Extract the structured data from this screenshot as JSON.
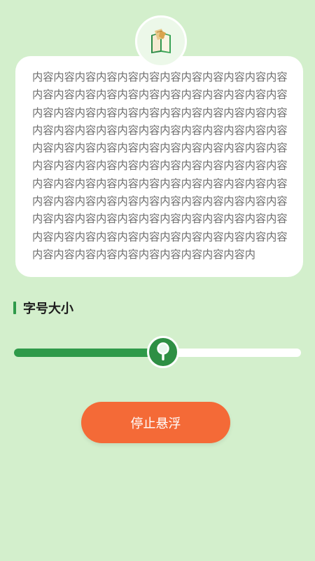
{
  "header": {
    "icon": "book-icon"
  },
  "preview": {
    "text": "内容内容内容内容内容内容内容内容内容内容内容内容内容内容内容内容内容内容内容内容内容内容内容内容内容内容内容内容内容内容内容内容内容内容内容内容内容内容内容内容内容内容内容内容内容内容内容内容内容内容内容内容内容内容内容内容内容内容内容内容内容内容内容内容内容内容内容内容内容内容内容内容内容内容内容内容内容内容内容内容内容内容内容内容内容内容内容内容内容内容内容内容内容内容内容内容内容内容内容内容内容内容内容内容内容内容内容内容内容内容内容内容内容内容内容内容内容内容内容内容内容内容内容内容内容内容内容内容内容内容内"
  },
  "font_size": {
    "label": "字号大小",
    "slider_value": 0.52,
    "thumb_icon": "magnifier-icon"
  },
  "actions": {
    "stop_label": "停止悬浮"
  },
  "colors": {
    "background": "#d3efcc",
    "accent_green": "#2f9a4a",
    "button_orange": "#f46a37"
  }
}
